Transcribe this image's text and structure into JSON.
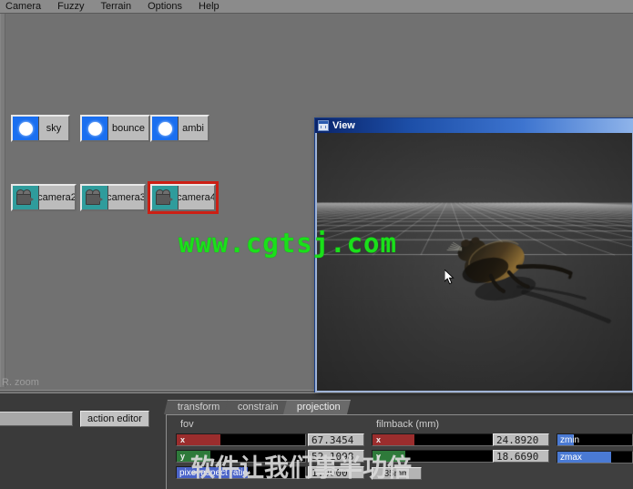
{
  "menubar": {
    "items": [
      {
        "label": "Camera",
        "name": "menu-camera"
      },
      {
        "label": "Fuzzy",
        "name": "menu-fuzzy"
      },
      {
        "label": "Terrain",
        "name": "menu-terrain"
      },
      {
        "label": "Options",
        "name": "menu-options"
      },
      {
        "label": "Help",
        "name": "menu-help"
      }
    ]
  },
  "nodes": {
    "lights": [
      {
        "label": "sky",
        "icon": "point-light-icon"
      },
      {
        "label": "bounce",
        "icon": "point-light-icon"
      },
      {
        "label": "ambi",
        "icon": "point-light-icon"
      }
    ],
    "cameras": [
      {
        "label": "camera2",
        "icon": "camera-icon",
        "selected": false
      },
      {
        "label": "camera3",
        "icon": "camera-icon",
        "selected": false
      },
      {
        "label": "camera4",
        "icon": "camera-icon",
        "selected": true
      }
    ],
    "selection_color": "#cc1f14"
  },
  "watermarks": {
    "top": "www.cgtsj.com",
    "top_color": "#1ae01a",
    "bottom": "软件让我们事半功倍"
  },
  "status": {
    "text": "R. zoom"
  },
  "toolbar": {
    "action_editor_label": "action editor",
    "text_field_value": ""
  },
  "view_window": {
    "title": "View",
    "icon": "window-icon",
    "titlebar_color": "#0a246a"
  },
  "attributes": {
    "tabs": [
      {
        "label": "transform",
        "active": false
      },
      {
        "label": "constrain",
        "active": false
      },
      {
        "label": "projection",
        "active": true
      }
    ],
    "groups": [
      {
        "label": "fov"
      },
      {
        "label": "filmback (mm)"
      }
    ],
    "fov": {
      "x": {
        "channel": "x",
        "value": "67.3454",
        "fill_color": "#9b2d2d",
        "fill_pct": 34
      },
      "y": {
        "channel": "y",
        "value": "52.1098",
        "fill_color": "#2e7a3a",
        "fill_pct": 26
      }
    },
    "filmback": {
      "x": {
        "channel": "x",
        "value": "24.8920",
        "fill_color": "#9b2d2d",
        "fill_pct": 26
      },
      "y": {
        "channel": "y",
        "value": "18.6690",
        "fill_color": "#2e7a3a",
        "fill_pct": 20
      }
    },
    "pixel_aspect_ratio": {
      "label": "pixel aspect ratio",
      "value": "1.0000",
      "fill_color": "#4a63c8",
      "fill_pct": 55
    },
    "preset_button": {
      "label": "35mm"
    },
    "clip": {
      "zmin": {
        "label": "zmin",
        "fill_color": "#4a7ad4",
        "fill_pct": 22
      },
      "zmax": {
        "label": "zmax",
        "fill_color": "#4a7ad4",
        "fill_pct": 72
      }
    }
  }
}
